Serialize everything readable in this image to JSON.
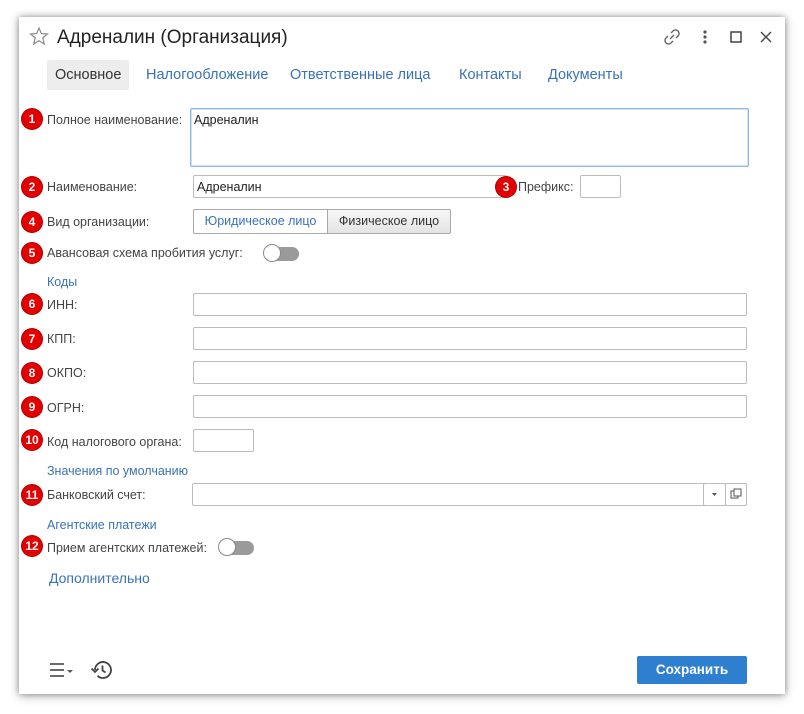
{
  "window": {
    "title": "Адреналин (Организация)"
  },
  "tabs": [
    {
      "label": "Основное"
    },
    {
      "label": "Налогообложение"
    },
    {
      "label": "Ответственные лица"
    },
    {
      "label": "Контакты"
    },
    {
      "label": "Документы"
    }
  ],
  "badges": [
    "1",
    "2",
    "3",
    "4",
    "5",
    "6",
    "7",
    "8",
    "9",
    "10",
    "11",
    "12"
  ],
  "form": {
    "full_name": {
      "label": "Полное наименование:",
      "value": "Адреналин"
    },
    "name": {
      "label": "Наименование:",
      "value": "Адреналин"
    },
    "prefix": {
      "label": "Префикс:",
      "value": ""
    },
    "org_type": {
      "label": "Вид организации:",
      "options": [
        "Юридическое лицо",
        "Физическое лицо"
      ],
      "selected": "Юридическое лицо"
    },
    "advance_scheme": {
      "label": "Авансовая схема пробития услуг:",
      "enabled": false
    },
    "codes_section": "Коды",
    "inn": {
      "label": "ИНН:",
      "value": ""
    },
    "kpp": {
      "label": "КПП:",
      "value": ""
    },
    "okpo": {
      "label": "ОКПО:",
      "value": ""
    },
    "ogrn": {
      "label": "ОГРН:",
      "value": ""
    },
    "tax_code": {
      "label": "Код налогового органа:",
      "value": ""
    },
    "defaults_section": "Значения по умолчанию",
    "bank_account": {
      "label": "Банковский счет:",
      "value": ""
    },
    "agent_section": "Агентские платежи",
    "agent_payments": {
      "label": "Прием агентских платежей:",
      "enabled": false
    },
    "more_link": "Дополнительно"
  },
  "footer": {
    "save_label": "Сохранить"
  },
  "colors": {
    "accent": "#2f7fd1",
    "link": "#3a72b8",
    "badge": "#e30000"
  }
}
